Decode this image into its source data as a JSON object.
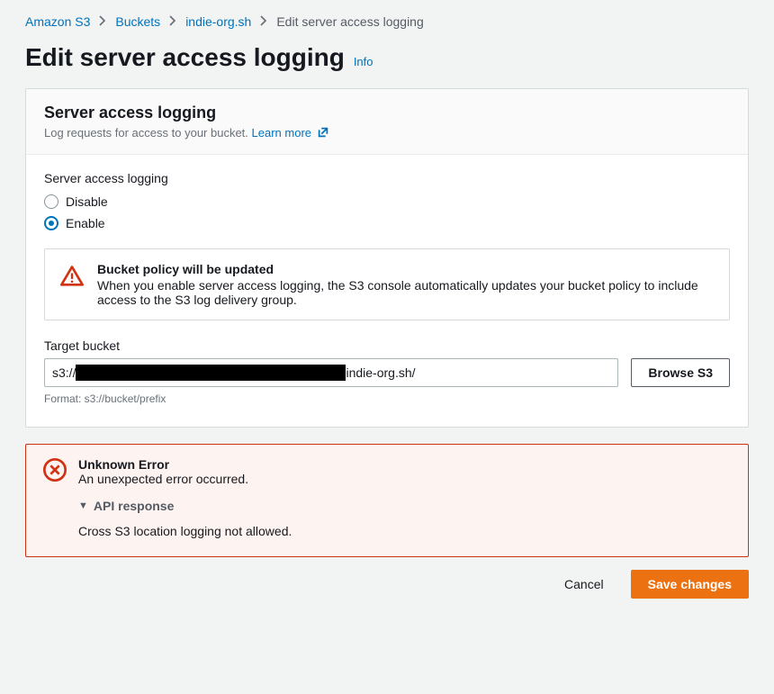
{
  "breadcrumbs": {
    "items": [
      {
        "label": "Amazon S3",
        "link": true
      },
      {
        "label": "Buckets",
        "link": true
      },
      {
        "label": "indie-org.sh",
        "link": true
      },
      {
        "label": "Edit server access logging",
        "link": false
      }
    ]
  },
  "page": {
    "title": "Edit server access logging",
    "info": "Info"
  },
  "panel": {
    "heading": "Server access logging",
    "description": "Log requests for access to your bucket.",
    "learn_more": "Learn more",
    "logging_label": "Server access logging",
    "options": {
      "disable": "Disable",
      "enable": "Enable"
    },
    "selected": "enable",
    "callout": {
      "title": "Bucket policy will be updated",
      "text": "When you enable server access logging, the S3 console automatically updates your bucket policy to include access to the S3 log delivery group."
    },
    "target": {
      "label": "Target bucket",
      "value_prefix": "s3://",
      "value_suffix": "indie-org.sh/",
      "browse": "Browse S3",
      "hint": "Format: s3://bucket/prefix"
    }
  },
  "error": {
    "title": "Unknown Error",
    "subtitle": "An unexpected error occurred.",
    "expand_label": "API response",
    "message": "Cross S3 location logging not allowed."
  },
  "actions": {
    "cancel": "Cancel",
    "save": "Save changes"
  }
}
